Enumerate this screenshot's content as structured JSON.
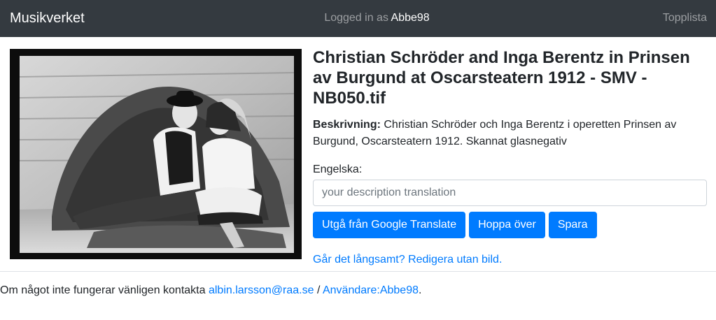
{
  "navbar": {
    "brand": "Musikverket",
    "logged_prefix": "Logged in as",
    "username": "Abbe98",
    "toplist": "Topplista"
  },
  "photo": {
    "icon": "photograph-image"
  },
  "main": {
    "title": "Christian Schröder and Inga Berentz in Prinsen av Burgund at Oscarsteatern 1912 - SMV - NB050.tif",
    "description_label": "Beskrivning:",
    "description_text": "Christian Schröder och Inga Berentz i operetten Prinsen av Burgund, Oscarsteatern 1912. Skannat glasnegativ",
    "english_label": "Engelska:",
    "translation_placeholder": "your description translation",
    "translation_value": "",
    "buttons": {
      "google": "Utgå från Google Translate",
      "skip": "Hoppa över",
      "save": "Spara"
    },
    "slow_link": "Går det långsamt? Redigera utan bild."
  },
  "footer": {
    "text_before": "Om något inte fungerar vänligen kontakta",
    "email": "albin.larsson@raa.se",
    "separator": "/",
    "user_link": "Användare:Abbe98",
    "end": "."
  },
  "colors": {
    "navbar_bg": "#343a40",
    "primary": "#007bff",
    "text": "#212529"
  }
}
